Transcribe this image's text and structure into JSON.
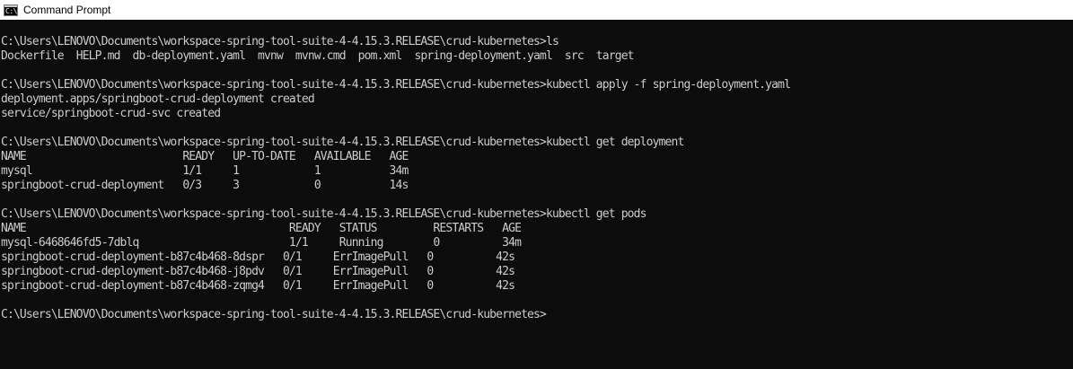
{
  "window": {
    "title": "Command Prompt",
    "icon": "cmd-icon",
    "icon_glyph": "C:\\",
    "colors": {
      "titlebar_bg": "#ffffff",
      "console_bg": "#0c0c0c",
      "console_fg": "#cccccc"
    }
  },
  "console": {
    "lines": [
      "C:\\Users\\LENOVO\\Documents\\workspace-spring-tool-suite-4-4.15.3.RELEASE\\crud-kubernetes>ls",
      "Dockerfile  HELP.md  db-deployment.yaml  mvnw  mvnw.cmd  pom.xml  spring-deployment.yaml  src  target",
      "",
      "C:\\Users\\LENOVO\\Documents\\workspace-spring-tool-suite-4-4.15.3.RELEASE\\crud-kubernetes>kubectl apply -f spring-deployment.yaml",
      "deployment.apps/springboot-crud-deployment created",
      "service/springboot-crud-svc created",
      "",
      "C:\\Users\\LENOVO\\Documents\\workspace-spring-tool-suite-4-4.15.3.RELEASE\\crud-kubernetes>kubectl get deployment",
      "NAME                         READY   UP-TO-DATE   AVAILABLE   AGE",
      "mysql                        1/1     1            1           34m",
      "springboot-crud-deployment   0/3     3            0           14s",
      "",
      "C:\\Users\\LENOVO\\Documents\\workspace-spring-tool-suite-4-4.15.3.RELEASE\\crud-kubernetes>kubectl get pods",
      "NAME                                          READY   STATUS         RESTARTS   AGE",
      "mysql-6468646fd5-7dblq                        1/1     Running        0          34m",
      "springboot-crud-deployment-b87c4b468-8dspr   0/1     ErrImagePull   0          42s",
      "springboot-crud-deployment-b87c4b468-j8pdv   0/1     ErrImagePull   0          42s",
      "springboot-crud-deployment-b87c4b468-zqmg4   0/1     ErrImagePull   0          42s",
      "",
      "C:\\Users\\LENOVO\\Documents\\workspace-spring-tool-suite-4-4.15.3.RELEASE\\crud-kubernetes>"
    ]
  }
}
